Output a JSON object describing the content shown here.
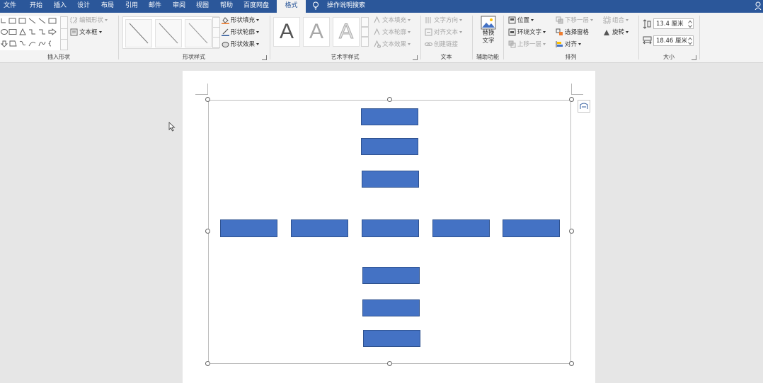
{
  "menu": {
    "tabs": [
      "文件",
      "开始",
      "插入",
      "设计",
      "布局",
      "引用",
      "邮件",
      "审阅",
      "视图",
      "帮助",
      "百度网盘",
      "格式"
    ],
    "active_tab": "格式",
    "tell_me": "操作说明搜索"
  },
  "ribbon": {
    "insert_shapes": {
      "edit_shape": "编辑形状",
      "text_box": "文本框",
      "label": "插入形状"
    },
    "shape_styles": {
      "fill": "形状填充",
      "outline": "形状轮廓",
      "effects": "形状效果",
      "label": "形状样式"
    },
    "wordart_styles": {
      "glyph": "A",
      "text_fill": "文本填充",
      "text_outline": "文本轮廓",
      "text_effects": "文本效果",
      "label": "艺术字样式"
    },
    "text": {
      "direction": "文字方向",
      "align": "对齐文本",
      "create_link": "创建链接",
      "label": "文本"
    },
    "accessibility": {
      "alt_text_line1": "替换",
      "alt_text_line2": "文字",
      "label": "辅助功能"
    },
    "arrange": {
      "position": "位置",
      "wrap_text": "环绕文字",
      "bring_forward": "上移一层",
      "send_backward": "下移一层",
      "selection_pane": "选择窗格",
      "align": "对齐",
      "group": "组合",
      "rotate": "旋转",
      "label": "排列"
    },
    "size": {
      "height": "13.4 厘米",
      "width": "18.46 厘米",
      "label": "大小"
    }
  },
  "colors": {
    "accent": "#2b579a",
    "shape_fill": "#4472c4",
    "shape_border": "#2f528f"
  }
}
